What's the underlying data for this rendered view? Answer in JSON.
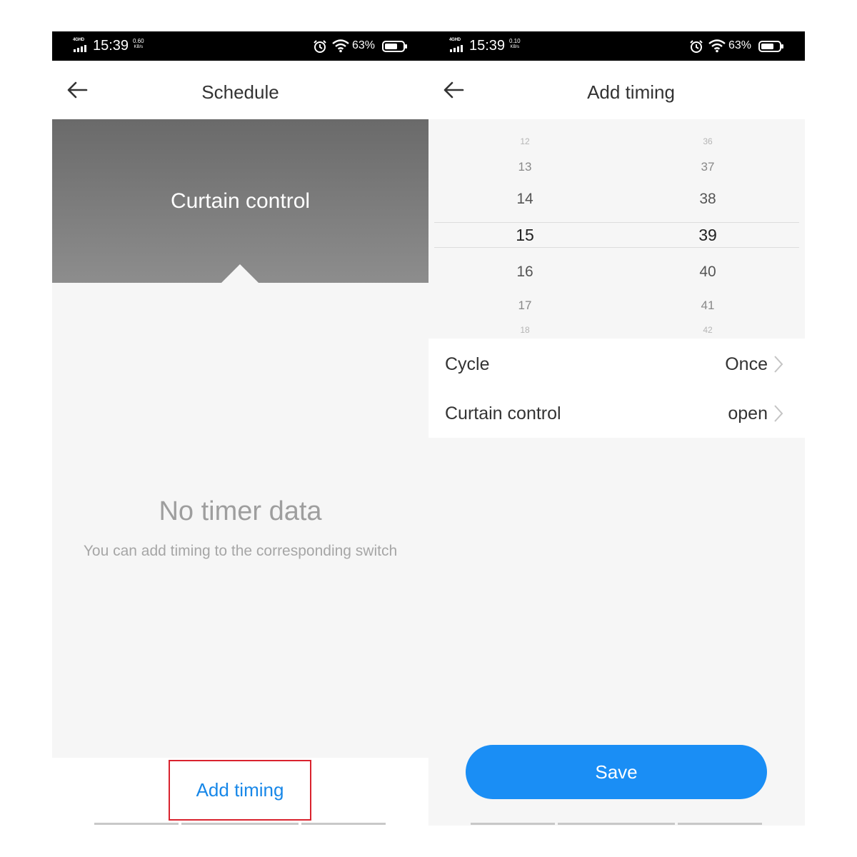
{
  "screens": [
    {
      "status": {
        "network": "4GHD",
        "time": "15:39",
        "speed_value": "0.60",
        "speed_unit": "KB/s",
        "battery": "63%"
      },
      "nav": {
        "title": "Schedule",
        "back_icon": "arrow-left-icon"
      },
      "banner": {
        "title": "Curtain control"
      },
      "empty_state": {
        "title": "No timer data",
        "subtitle": "You can add timing to the corresponding switch"
      },
      "bottom": {
        "add_timing_label": "Add timing",
        "highlight_color": "#d9232e"
      }
    },
    {
      "status": {
        "network": "4GHD",
        "time": "15:39",
        "speed_value": "0.10",
        "speed_unit": "KB/s",
        "battery": "63%"
      },
      "nav": {
        "title": "Add timing",
        "back_icon": "arrow-left-icon"
      },
      "picker": {
        "hours": [
          "12",
          "13",
          "14",
          "15",
          "16",
          "17",
          "18"
        ],
        "minutes": [
          "36",
          "37",
          "38",
          "39",
          "40",
          "41",
          "42"
        ],
        "selected_hour": "15",
        "selected_minute": "39"
      },
      "settings": [
        {
          "label": "Cycle",
          "value": "Once"
        },
        {
          "label": "Curtain control",
          "value": "open"
        }
      ],
      "save_label": "Save"
    }
  ],
  "colors": {
    "accent": "#1a8ef5",
    "link": "#1787e8",
    "background": "#f6f6f6"
  }
}
